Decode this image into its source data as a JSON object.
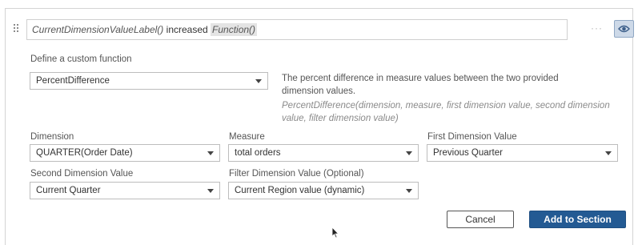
{
  "expression": {
    "dimension_token": "CurrentDimensionValueLabel()",
    "connector": " increased ",
    "function_token": "Function()"
  },
  "toolbar": {
    "more_label": "···",
    "eye_icon": "eye-icon"
  },
  "custom_function": {
    "heading": "Define a custom function",
    "selected": "PercentDifference",
    "description": "The percent difference in measure values between the two provided dimension values.",
    "syntax": "PercentDifference(dimension, measure, first dimension value, second dimension value, filter dimension value)"
  },
  "fields": {
    "dimension": {
      "label": "Dimension",
      "value": "QUARTER(Order Date)"
    },
    "measure": {
      "label": "Measure",
      "value": "total orders"
    },
    "first_dimension_value": {
      "label": "First Dimension Value",
      "value": "Previous Quarter"
    },
    "second_dimension_value": {
      "label": "Second Dimension Value",
      "value": "Current Quarter"
    },
    "filter_dimension_value": {
      "label": "Filter Dimension Value (Optional)",
      "value": "Current Region value (dynamic)"
    }
  },
  "actions": {
    "cancel_label": "Cancel",
    "add_label": "Add to Section"
  },
  "colors": {
    "primary_button": "#235a93",
    "eye_button_bg": "#cdd9e8"
  }
}
